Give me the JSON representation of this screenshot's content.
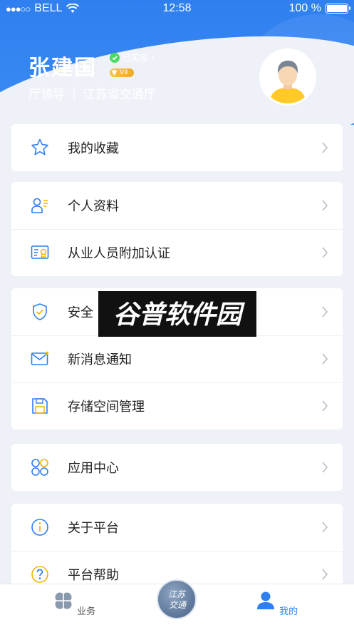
{
  "status_bar": {
    "carrier": "BELL",
    "time": "12:58",
    "battery": "100 %",
    "battery_level": 1.0
  },
  "profile": {
    "name": "张建国",
    "verified_label": "已实名 ›",
    "vip_level": "V4",
    "role": "厅领导",
    "separator": "|",
    "organization": "江苏省交通厅"
  },
  "menu_groups": [
    [
      {
        "label": "我的收藏",
        "icon": "star-icon"
      }
    ],
    [
      {
        "label": "个人资料",
        "icon": "profile-icon"
      },
      {
        "label": "从业人员附加认证",
        "icon": "certificate-icon"
      }
    ],
    [
      {
        "label": "安全",
        "icon": "shield-icon"
      },
      {
        "label": "新消息通知",
        "icon": "mail-icon"
      },
      {
        "label": "存储空间管理",
        "icon": "save-icon"
      }
    ],
    [
      {
        "label": "应用中心",
        "icon": "apps-icon"
      }
    ],
    [
      {
        "label": "关于平台",
        "icon": "info-icon"
      },
      {
        "label": "平台帮助",
        "icon": "help-icon"
      }
    ]
  ],
  "watermark": {
    "text": "谷普软件园"
  },
  "tabbar": {
    "business": "业务",
    "center_logo_text": "江苏交通",
    "mine": "我的",
    "active_color": "#2f7ff0"
  },
  "colors": {
    "primary": "#2f7ff0",
    "verified": "#4cd964",
    "vip": "#f5c542"
  }
}
